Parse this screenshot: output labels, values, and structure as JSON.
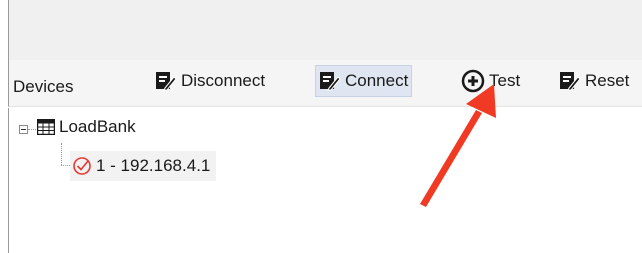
{
  "toolbar": {
    "title": "Devices",
    "buttons": [
      {
        "label": "Disconnect",
        "icon": "edit-document-icon"
      },
      {
        "label": "Connect",
        "icon": "edit-document-icon",
        "state": "hover"
      },
      {
        "label": "Test",
        "icon": "add-circle-icon"
      },
      {
        "label": "Reset",
        "icon": "edit-document-icon"
      }
    ]
  },
  "tree": {
    "root": {
      "label": "LoadBank",
      "icon": "table-icon",
      "expanded": true
    },
    "children": [
      {
        "label": "1 - 192.168.4.1",
        "icon": "error-check-icon",
        "status_color": "#e53935",
        "selected": true
      }
    ]
  },
  "annotation": {
    "type": "arrow",
    "color": "#f03a24",
    "points_to": "Test"
  }
}
